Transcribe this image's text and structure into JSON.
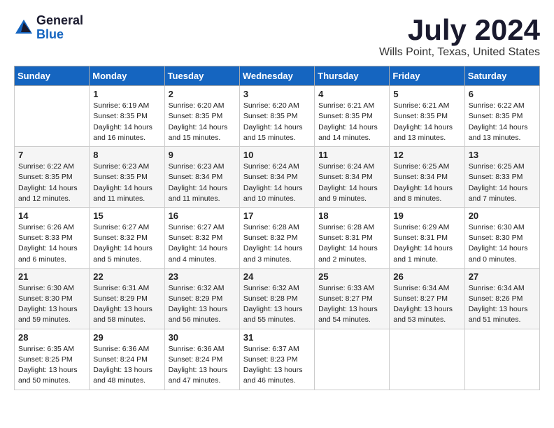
{
  "header": {
    "logo_general": "General",
    "logo_blue": "Blue",
    "month_title": "July 2024",
    "location": "Wills Point, Texas, United States"
  },
  "days_of_week": [
    "Sunday",
    "Monday",
    "Tuesday",
    "Wednesday",
    "Thursday",
    "Friday",
    "Saturday"
  ],
  "weeks": [
    [
      {
        "day": "",
        "info": ""
      },
      {
        "day": "1",
        "info": "Sunrise: 6:19 AM\nSunset: 8:35 PM\nDaylight: 14 hours\nand 16 minutes."
      },
      {
        "day": "2",
        "info": "Sunrise: 6:20 AM\nSunset: 8:35 PM\nDaylight: 14 hours\nand 15 minutes."
      },
      {
        "day": "3",
        "info": "Sunrise: 6:20 AM\nSunset: 8:35 PM\nDaylight: 14 hours\nand 15 minutes."
      },
      {
        "day": "4",
        "info": "Sunrise: 6:21 AM\nSunset: 8:35 PM\nDaylight: 14 hours\nand 14 minutes."
      },
      {
        "day": "5",
        "info": "Sunrise: 6:21 AM\nSunset: 8:35 PM\nDaylight: 14 hours\nand 13 minutes."
      },
      {
        "day": "6",
        "info": "Sunrise: 6:22 AM\nSunset: 8:35 PM\nDaylight: 14 hours\nand 13 minutes."
      }
    ],
    [
      {
        "day": "7",
        "info": "Sunrise: 6:22 AM\nSunset: 8:35 PM\nDaylight: 14 hours\nand 12 minutes."
      },
      {
        "day": "8",
        "info": "Sunrise: 6:23 AM\nSunset: 8:35 PM\nDaylight: 14 hours\nand 11 minutes."
      },
      {
        "day": "9",
        "info": "Sunrise: 6:23 AM\nSunset: 8:34 PM\nDaylight: 14 hours\nand 11 minutes."
      },
      {
        "day": "10",
        "info": "Sunrise: 6:24 AM\nSunset: 8:34 PM\nDaylight: 14 hours\nand 10 minutes."
      },
      {
        "day": "11",
        "info": "Sunrise: 6:24 AM\nSunset: 8:34 PM\nDaylight: 14 hours\nand 9 minutes."
      },
      {
        "day": "12",
        "info": "Sunrise: 6:25 AM\nSunset: 8:34 PM\nDaylight: 14 hours\nand 8 minutes."
      },
      {
        "day": "13",
        "info": "Sunrise: 6:25 AM\nSunset: 8:33 PM\nDaylight: 14 hours\nand 7 minutes."
      }
    ],
    [
      {
        "day": "14",
        "info": "Sunrise: 6:26 AM\nSunset: 8:33 PM\nDaylight: 14 hours\nand 6 minutes."
      },
      {
        "day": "15",
        "info": "Sunrise: 6:27 AM\nSunset: 8:32 PM\nDaylight: 14 hours\nand 5 minutes."
      },
      {
        "day": "16",
        "info": "Sunrise: 6:27 AM\nSunset: 8:32 PM\nDaylight: 14 hours\nand 4 minutes."
      },
      {
        "day": "17",
        "info": "Sunrise: 6:28 AM\nSunset: 8:32 PM\nDaylight: 14 hours\nand 3 minutes."
      },
      {
        "day": "18",
        "info": "Sunrise: 6:28 AM\nSunset: 8:31 PM\nDaylight: 14 hours\nand 2 minutes."
      },
      {
        "day": "19",
        "info": "Sunrise: 6:29 AM\nSunset: 8:31 PM\nDaylight: 14 hours\nand 1 minute."
      },
      {
        "day": "20",
        "info": "Sunrise: 6:30 AM\nSunset: 8:30 PM\nDaylight: 14 hours\nand 0 minutes."
      }
    ],
    [
      {
        "day": "21",
        "info": "Sunrise: 6:30 AM\nSunset: 8:30 PM\nDaylight: 13 hours\nand 59 minutes."
      },
      {
        "day": "22",
        "info": "Sunrise: 6:31 AM\nSunset: 8:29 PM\nDaylight: 13 hours\nand 58 minutes."
      },
      {
        "day": "23",
        "info": "Sunrise: 6:32 AM\nSunset: 8:29 PM\nDaylight: 13 hours\nand 56 minutes."
      },
      {
        "day": "24",
        "info": "Sunrise: 6:32 AM\nSunset: 8:28 PM\nDaylight: 13 hours\nand 55 minutes."
      },
      {
        "day": "25",
        "info": "Sunrise: 6:33 AM\nSunset: 8:27 PM\nDaylight: 13 hours\nand 54 minutes."
      },
      {
        "day": "26",
        "info": "Sunrise: 6:34 AM\nSunset: 8:27 PM\nDaylight: 13 hours\nand 53 minutes."
      },
      {
        "day": "27",
        "info": "Sunrise: 6:34 AM\nSunset: 8:26 PM\nDaylight: 13 hours\nand 51 minutes."
      }
    ],
    [
      {
        "day": "28",
        "info": "Sunrise: 6:35 AM\nSunset: 8:25 PM\nDaylight: 13 hours\nand 50 minutes."
      },
      {
        "day": "29",
        "info": "Sunrise: 6:36 AM\nSunset: 8:24 PM\nDaylight: 13 hours\nand 48 minutes."
      },
      {
        "day": "30",
        "info": "Sunrise: 6:36 AM\nSunset: 8:24 PM\nDaylight: 13 hours\nand 47 minutes."
      },
      {
        "day": "31",
        "info": "Sunrise: 6:37 AM\nSunset: 8:23 PM\nDaylight: 13 hours\nand 46 minutes."
      },
      {
        "day": "",
        "info": ""
      },
      {
        "day": "",
        "info": ""
      },
      {
        "day": "",
        "info": ""
      }
    ]
  ]
}
